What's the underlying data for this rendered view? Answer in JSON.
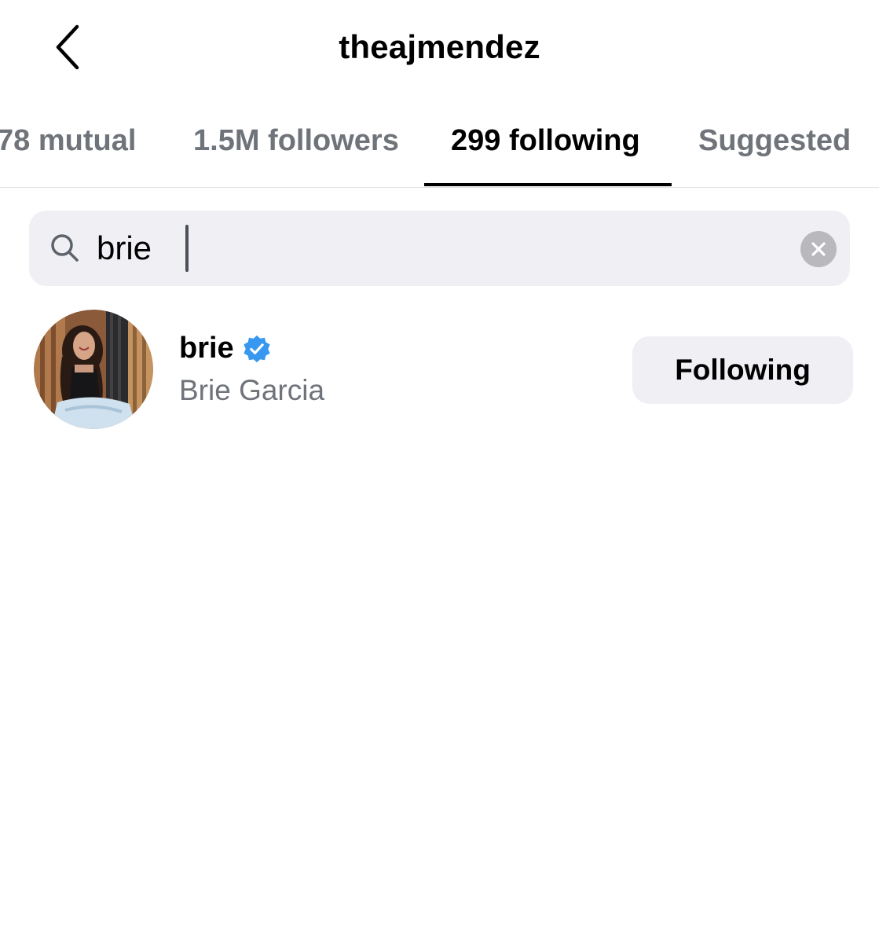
{
  "header": {
    "title": "theajmendez",
    "back_icon": "chevron-left-icon"
  },
  "tabs": [
    {
      "label": "78 mutual",
      "active": false
    },
    {
      "label": "1.5M followers",
      "active": false
    },
    {
      "label": "299 following",
      "active": true
    },
    {
      "label": "Suggested",
      "active": false
    }
  ],
  "search": {
    "value": "brie",
    "icon": "search-icon",
    "clear_icon": "clear-icon"
  },
  "results": [
    {
      "username": "brie",
      "verified": true,
      "full_name": "Brie Garcia",
      "button_label": "Following"
    }
  ],
  "colors": {
    "text_primary": "#000000",
    "text_secondary": "#6f737a",
    "field_background": "#efeff4",
    "verified_blue": "#3897f0"
  }
}
